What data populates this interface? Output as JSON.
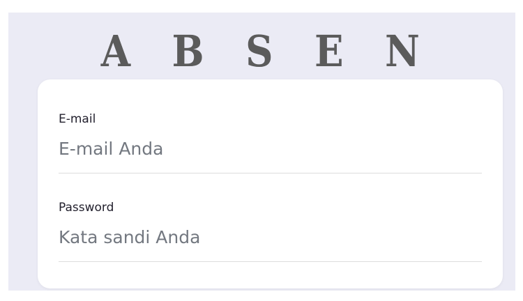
{
  "app": {
    "title": "A B S E N"
  },
  "form": {
    "email": {
      "label": "E-mail",
      "placeholder": "E-mail Anda",
      "value": ""
    },
    "password": {
      "label": "Password",
      "placeholder": "Kata sandi Anda",
      "value": ""
    }
  },
  "colors": {
    "background": "#ebebf5",
    "card": "#ffffff",
    "title": "#5b5b5b",
    "label": "#23212e",
    "placeholder": "#737880",
    "divider": "#dcdcdc"
  }
}
